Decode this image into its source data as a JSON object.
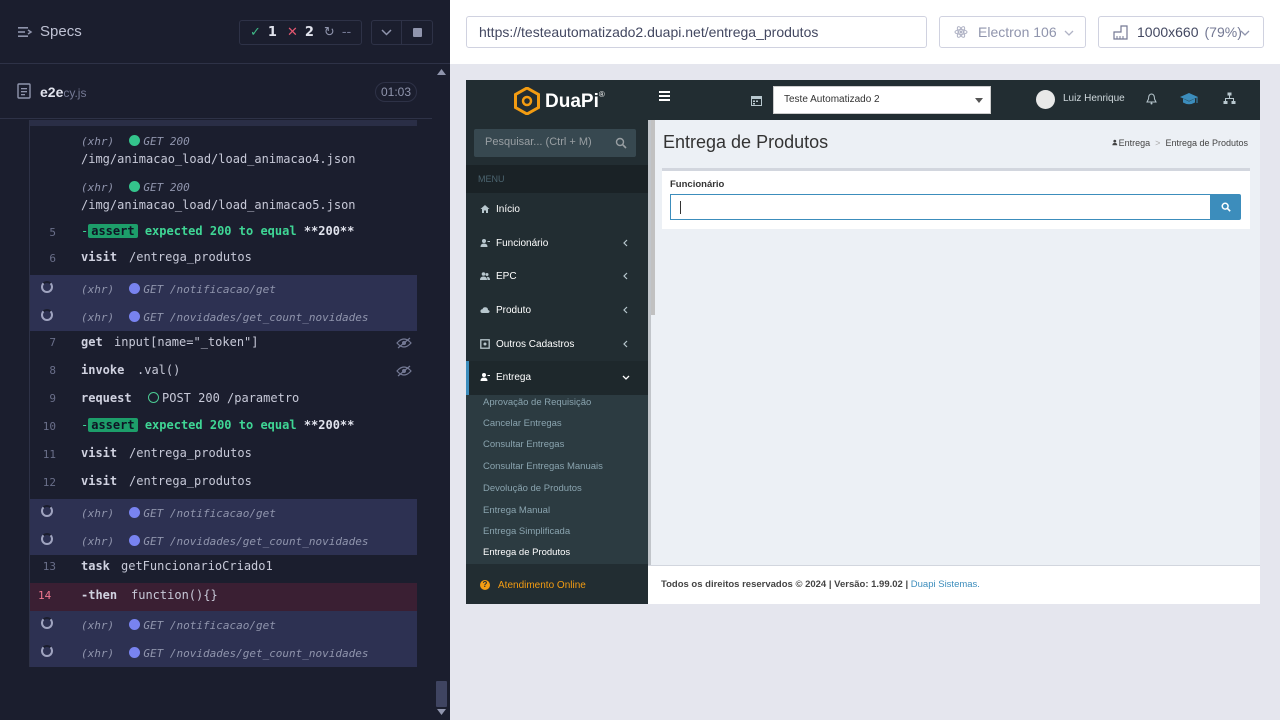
{
  "cypress": {
    "header": {
      "title": "Specs"
    },
    "stats": {
      "pass_icon": "✓",
      "passed": "1",
      "fail_icon": "✕",
      "failed": "2",
      "pending_icon": "↻",
      "pending": "--"
    },
    "spec": {
      "name": "e2e",
      "ext": "cy.js",
      "timer": "01:03"
    },
    "commands": [
      {
        "type": "xhr",
        "label": "(xhr)",
        "status": "GET 200",
        "path": "/img/animacao_load/load_animacao4.json"
      },
      {
        "type": "xhr",
        "label": "(xhr)",
        "status": "GET 200",
        "path": "/img/animacao_load/load_animacao5.json"
      },
      {
        "num": "5",
        "prefix": "-",
        "badge": "assert",
        "text1": "expected",
        "v1": "200",
        "text2": "to equal",
        "v2": "**200**"
      },
      {
        "num": "6",
        "name": "visit",
        "msg": "/entrega_produtos"
      },
      {
        "label": "(xhr)",
        "msg": "GET /notificacao/get"
      },
      {
        "label": "(xhr)",
        "msg": "GET /novidades/get_count_novidades"
      },
      {
        "num": "7",
        "name": "get",
        "msg": "input[name=\"_token\"]"
      },
      {
        "num": "8",
        "name": "invoke",
        "msg": ".val()"
      },
      {
        "num": "9",
        "name": "request",
        "msg": "POST 200 /parametro"
      },
      {
        "num": "10",
        "prefix": "-",
        "badge": "assert",
        "text1": "expected",
        "v1": "200",
        "text2": "to equal",
        "v2": "**200**"
      },
      {
        "num": "11",
        "name": "visit",
        "msg": "/entrega_produtos"
      },
      {
        "num": "12",
        "name": "visit",
        "msg": "/entrega_produtos"
      },
      {
        "label": "(xhr)",
        "msg": "GET /notificacao/get"
      },
      {
        "label": "(xhr)",
        "msg": "GET /novidades/get_count_novidades"
      },
      {
        "num": "13",
        "name": "task",
        "msg": "getFuncionarioCriado1"
      },
      {
        "num": "14",
        "name": "-then",
        "msg": "function(){}"
      },
      {
        "label": "(xhr)",
        "msg": "GET /notificacao/get"
      },
      {
        "label": "(xhr)",
        "msg": "GET /novidades/get_count_novidades"
      }
    ]
  },
  "toolbar": {
    "url": "https://testeautomatizado2.duapi.net/entrega_produtos",
    "browser": "Electron 106",
    "viewport": "1000x660",
    "scale": "(79%)"
  },
  "app": {
    "logo": "DuaPi",
    "logo_reg": "®",
    "company": "Teste Automatizado 2",
    "user": "Luiz Henrique",
    "search_placeholder": "Pesquisar... (Ctrl + M)",
    "menu_header": "MENU",
    "menu": [
      {
        "label": "Início",
        "icon": "home-icon"
      },
      {
        "label": "Funcionário",
        "icon": "user-icon"
      },
      {
        "label": "EPC",
        "icon": "users-icon"
      },
      {
        "label": "Produto",
        "icon": "cloud-icon"
      },
      {
        "label": "Outros Cadastros",
        "icon": "box-icon"
      },
      {
        "label": "Entrega",
        "icon": "user-icon"
      }
    ],
    "submenu": [
      "Aprovação de Requisição",
      "Cancelar Entregas",
      "Consultar Entregas",
      "Consultar Entregas Manuais",
      "Devolução de Produtos",
      "Entrega Manual",
      "Entrega Simplificada",
      "Entrega de Produtos"
    ],
    "online_help": "Atendimento Online",
    "page_title": "Entrega de Produtos",
    "breadcrumb": [
      "Entrega",
      "Entrega de Produtos"
    ],
    "field_label": "Funcionário",
    "footer_text": "Todos os direitos reservados © 2024 | Versão: 1.99.02 |",
    "footer_link": "Duapi Sistemas."
  },
  "colors": {
    "cypress_bg": "#1b1e2e",
    "pass": "#3fb987",
    "fail": "#e45770",
    "sidebar": "#222d32",
    "accent": "#3c8dbc",
    "logo_orange": "#f39c12"
  }
}
